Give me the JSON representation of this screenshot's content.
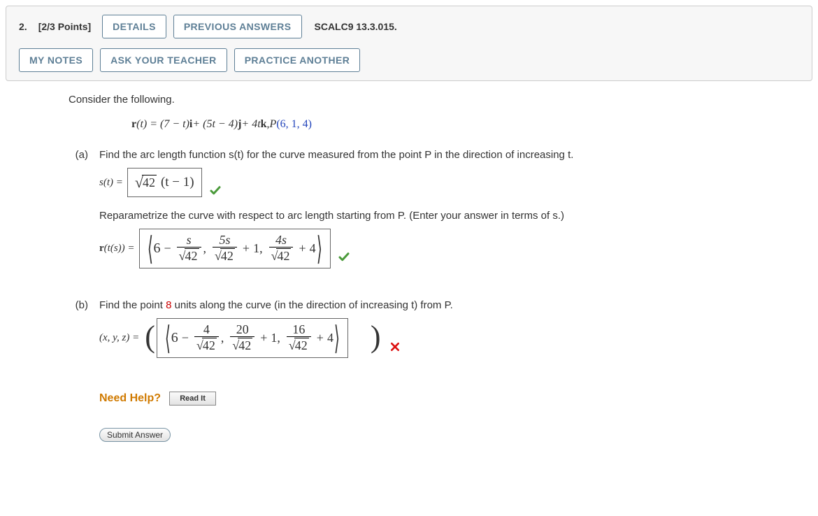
{
  "header": {
    "question_number": "2.",
    "points": "[2/3 Points]",
    "details_btn": "DETAILS",
    "prev_answers_btn": "PREVIOUS ANSWERS",
    "reference": "SCALC9 13.3.015.",
    "my_notes_btn": "MY NOTES",
    "ask_teacher_btn": "ASK YOUR TEACHER",
    "practice_btn": "PRACTICE ANOTHER"
  },
  "problem": {
    "intro": "Consider the following.",
    "equation_prefix": "r",
    "equation_body": "(t) = (7 − t)",
    "eq_i": "i",
    "eq_mid1": " + (5t − 4)",
    "eq_j": "j",
    "eq_mid2": " + 4t",
    "eq_k": "k",
    "eq_sep": ",   ",
    "eq_P": "P",
    "eq_Pargs": "(6, 1, 4)",
    "part_a_label": "(a)",
    "part_a_text1": "Find the arc length function s(t) for the curve measured from the point P in the direction of increasing t.",
    "answer_a1_label": "s(t) =",
    "answer_a1_sqrt": "42",
    "answer_a1_rest": "(t − 1)",
    "part_a_text2": "Reparametrize the curve with respect to arc length starting from P. (Enter your answer in terms of s.)",
    "answer_a2_label_prefix": "r",
    "answer_a2_label": "(t(s)) =",
    "part_b_label": "(b)",
    "part_b_text_pre": "Find the point ",
    "part_b_eight": "8",
    "part_b_text_post": " units along the curve (in the direction of increasing t) from P.",
    "answer_b_label": "(x, y, z) =",
    "need_help": "Need Help?",
    "read_it": "Read It",
    "submit": "Submit Answer"
  },
  "answers": {
    "a1": {
      "sqrt_arg": "42",
      "factor": "(t − 1)",
      "correct": true
    },
    "a2": {
      "term1_a": "6",
      "term1_num": "s",
      "term1_den_sqrt": "42",
      "term2_num": "5s",
      "term2_den_sqrt": "42",
      "term2_c": "1",
      "term3_num": "4s",
      "term3_den_sqrt": "42",
      "term3_c": "4",
      "correct": true
    },
    "b": {
      "term1_a": "6",
      "term1_num": "4",
      "term1_den_sqrt": "42",
      "term2_num": "20",
      "term2_den_sqrt": "42",
      "term2_c": "1",
      "term3_num": "16",
      "term3_den_sqrt": "42",
      "term3_c": "4",
      "correct": false
    }
  }
}
